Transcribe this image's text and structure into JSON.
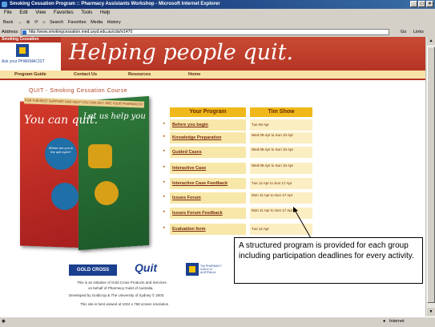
{
  "window": {
    "title": "Smoking Cessation Program :: Pharmacy Assistants Workshop - Microsoft Internet Explorer",
    "buttons": [
      "_",
      "□",
      "×"
    ]
  },
  "menu": [
    "File",
    "Edit",
    "View",
    "Favorites",
    "Tools",
    "Help"
  ],
  "toolbar": [
    "Back",
    "→",
    "⊗",
    "⟳",
    "⌂",
    "Search",
    "Favorites",
    "Media",
    "History"
  ],
  "address": {
    "label": "Address",
    "url": "http://www.smokingcessation.med.usyd.edu.au/cds/iv1470",
    "go": "Go",
    "links": "Links"
  },
  "header": {
    "logo_top": "Smoking Cessation",
    "logo_text": "Ask your PHARMACIST",
    "headline": "Helping people quit."
  },
  "nav": [
    "Program Guide",
    "Contact Us",
    "Resources",
    "Home"
  ],
  "page_title": "QUIT - Smoking Cessation Course",
  "poster": {
    "band": "FOR THE BEST SUPPORT AND HELP YOU CAN GET, SEE YOUR PHARMACIST",
    "left_text": "You can quit.",
    "right_text": "Let us help you",
    "circle1": "Where are you in the quit cycle?"
  },
  "program": {
    "col1": "Your Program",
    "col2": "Tim Show",
    "rows": [
      {
        "name": "Before you begin",
        "date": "Tue 08 Apr"
      },
      {
        "name": "Knowledge Preparation",
        "date": "Wed 08 Apr to Sun 10 Apr"
      },
      {
        "name": "Guided Cases",
        "date": "Wed 08 Apr to Sun 10 Apr"
      },
      {
        "name": "Interactive Case",
        "date": "Wed 08 Apr to Sun 10 Apr"
      },
      {
        "name": "Interactive Case Feedback",
        "date": "Tue 12 Apr to Sun 17 Apr"
      },
      {
        "name": "Issues Forum",
        "date": "Mon 11 Apr to Sun 17 Apr"
      },
      {
        "name": "Issues Forum Feedback",
        "date": "Mon 11 Apr to Sun 17 Apr"
      },
      {
        "name": "Evaluation form",
        "date": "Tue 12 Apr"
      }
    ]
  },
  "callout": "A structured program is provided for each group including participation deadlines for every activity.",
  "footer": {
    "goldcross": "GOLD CROSS",
    "quit": "Quit",
    "psa": "The PHARMACY GUILD of AUSTRALIA",
    "line1": "This is an initiative of Gold Cross Products and Services",
    "line2": "on behalf of Pharmacy Guild of Australia.",
    "line3": "Developed by Goldcrop & The University of Sydney © 2003",
    "line4": "This site is best viewed at 1024 x 768 screen resolution"
  },
  "status": {
    "zone": "Internet"
  }
}
